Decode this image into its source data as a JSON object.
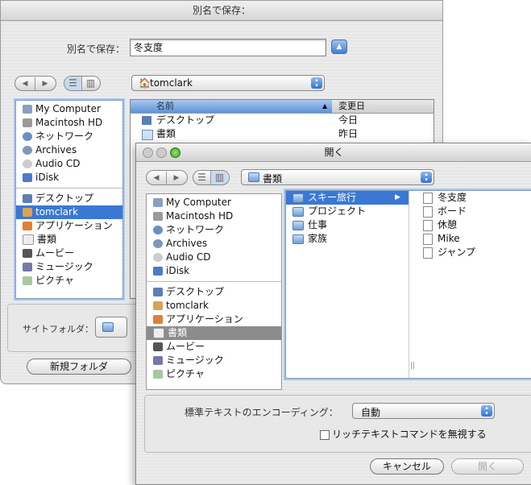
{
  "save_dialog": {
    "title": "別名で保存：",
    "save_as_label": "別名で保存：",
    "filename_value": "冬支度",
    "expand_icon": "triangle-up-icon",
    "location": "tomclark",
    "sidebar": {
      "devices": [
        "My Computer",
        "Macintosh HD",
        "ネットワーク",
        "Archives",
        "Audio CD",
        "iDisk"
      ],
      "places": [
        "デスクトップ",
        "tomclark",
        "アプリケーション",
        "書類",
        "ムービー",
        "ミュージック",
        "ピクチャ"
      ]
    },
    "columns": {
      "name": "名前",
      "modified": "変更日"
    },
    "rows": [
      {
        "name": "デスクトップ",
        "date": "今日"
      },
      {
        "name": "書類",
        "date": "昨日"
      }
    ],
    "site_folder_label": "サイトフォルダ：",
    "new_folder_button": "新規フォルダ"
  },
  "open_dialog": {
    "title": "開く",
    "location": "書類",
    "sidebar": {
      "devices": [
        "My Computer",
        "Macintosh HD",
        "ネットワーク",
        "Archives",
        "Audio CD",
        "iDisk"
      ],
      "places": [
        "デスクトップ",
        "tomclark",
        "アプリケーション",
        "書類",
        "ムービー",
        "ミュージック",
        "ピクチャ"
      ]
    },
    "folders": [
      "スキー旅行",
      "プロジェクト",
      "仕事",
      "家族"
    ],
    "files": [
      "冬支度",
      "ボード",
      "休憩",
      "Mike",
      "ジャンプ"
    ],
    "encoding_label": "標準テキストのエンコーディング：",
    "encoding_value": "自動",
    "ignore_rich_text": "リッチテキストコマンドを無視する",
    "cancel_button": "キャンセル",
    "open_button": "開く"
  },
  "colors": {
    "selection": "#3a78d4",
    "accent": "#2f73d0"
  }
}
